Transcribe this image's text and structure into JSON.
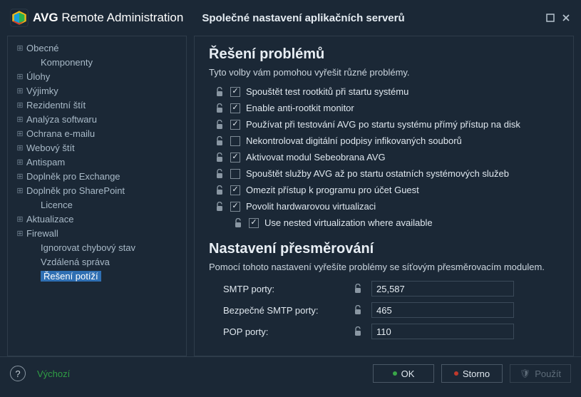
{
  "brand": {
    "name": "AVG",
    "product": "Remote Administration"
  },
  "subtitle": "Společné nastavení aplikačních serverů",
  "sidebar": {
    "items": [
      {
        "label": "Obecné",
        "expandable": true,
        "sub": false
      },
      {
        "label": "Komponenty",
        "expandable": false,
        "sub": true
      },
      {
        "label": "Úlohy",
        "expandable": true,
        "sub": false
      },
      {
        "label": "Výjimky",
        "expandable": true,
        "sub": false
      },
      {
        "label": "Rezidentní štít",
        "expandable": true,
        "sub": false
      },
      {
        "label": "Analýza softwaru",
        "expandable": true,
        "sub": false
      },
      {
        "label": "Ochrana e-mailu",
        "expandable": true,
        "sub": false
      },
      {
        "label": "Webový štít",
        "expandable": true,
        "sub": false
      },
      {
        "label": "Antispam",
        "expandable": true,
        "sub": false
      },
      {
        "label": "Doplněk pro Exchange",
        "expandable": true,
        "sub": false
      },
      {
        "label": "Doplněk pro SharePoint",
        "expandable": true,
        "sub": false
      },
      {
        "label": "Licence",
        "expandable": false,
        "sub": true
      },
      {
        "label": "Aktualizace",
        "expandable": true,
        "sub": false
      },
      {
        "label": "Firewall",
        "expandable": true,
        "sub": false
      },
      {
        "label": "Ignorovat chybový stav",
        "expandable": false,
        "sub": true
      },
      {
        "label": "Vzdálená správa",
        "expandable": false,
        "sub": true
      },
      {
        "label": "Řešení potíží",
        "expandable": false,
        "sub": true,
        "selected": true
      }
    ]
  },
  "sections": {
    "troubleshoot": {
      "title": "Řešení problémů",
      "hint": "Tyto volby vám pomohou vyřešit různé problémy.",
      "options": [
        {
          "label": "Spouštět test rootkitů při startu systému",
          "checked": true
        },
        {
          "label": "Enable anti-rootkit monitor",
          "checked": true
        },
        {
          "label": "Používat při testování AVG po startu systému přímý přístup na disk",
          "checked": true
        },
        {
          "label": "Nekontrolovat digitální podpisy infikovaných souborů",
          "checked": false
        },
        {
          "label": "Aktivovat modul Sebeobrana AVG",
          "checked": true
        },
        {
          "label": "Spouštět služby AVG až po startu ostatních systémových služeb",
          "checked": false
        },
        {
          "label": "Omezit přístup k programu pro účet Guest",
          "checked": true
        },
        {
          "label": "Povolit hardwarovou virtualizaci",
          "checked": true
        },
        {
          "label": "Use nested virtualization where available",
          "checked": true,
          "indent": true
        }
      ]
    },
    "redirect": {
      "title": "Nastavení přesměrování",
      "hint": "Pomocí tohoto nastavení vyřešíte problémy se síťovým přesměrovacím modulem.",
      "rows": [
        {
          "label": "SMTP porty:",
          "value": "25,587"
        },
        {
          "label": "Bezpečné SMTP porty:",
          "value": "465"
        },
        {
          "label": "POP porty:",
          "value": "110"
        }
      ]
    }
  },
  "footer": {
    "default": "Výchozí",
    "ok": "OK",
    "cancel": "Storno",
    "apply": "Použít"
  }
}
